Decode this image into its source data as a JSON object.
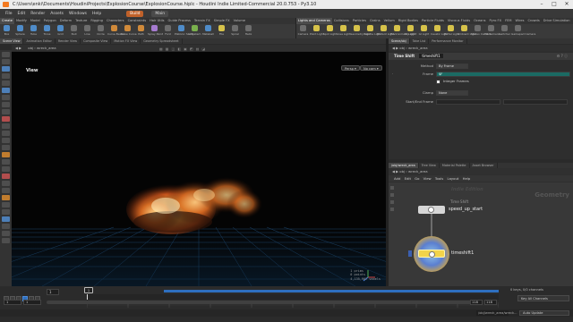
{
  "title_bar": {
    "text": "C:\\Users\\enki\\Documents\\HoudiniProjects\\ExplosionCourse\\ExplosionCourse.hiplc - Houdini Indie Limited-Commercial 20.0.753 - Py3.10"
  },
  "menu": {
    "items": [
      "File",
      "Edit",
      "Render",
      "Assets",
      "Windows",
      "Help"
    ],
    "build": "Build",
    "desktop": "Main"
  },
  "shelf_left": {
    "tabs": [
      "Create",
      "Modify",
      "Model",
      "Polygon",
      "Deform",
      "Texture",
      "Rigging",
      "Characters",
      "Constraints",
      "Hair Utils",
      "Guide Process",
      "Terrain FX",
      "Simple FX",
      "Volume"
    ],
    "tools": [
      "Box",
      "Sphere",
      "Tube",
      "Torus",
      "Grid",
      "Null",
      "Line",
      "Circle",
      "Curve Bezier",
      "Draw Curve",
      "Path",
      "Spray Paint",
      "Font",
      "Platonic Solids",
      "L-System",
      "Metaball",
      "File",
      "Spiral",
      "Helix"
    ]
  },
  "shelf_right": {
    "tabs": [
      "Lights and Cameras",
      "Collisions",
      "Particles",
      "Grains",
      "Vellum",
      "Rigid Bodies",
      "Particle Fluids",
      "Viscous Fluids",
      "Oceans",
      "Pyro FX",
      "FEM",
      "Wires",
      "Crowds",
      "Drive Simulation"
    ],
    "tools": [
      "Camera",
      "Point Light",
      "Spot Light",
      "Area Light",
      "Geometry Light",
      "Volume Light",
      "Distant Light",
      "Environment Light",
      "Sky Light",
      "GI Light",
      "Caustic Light",
      "Portal Light",
      "Ambient Light",
      "Stereo Camera",
      "VR Camera",
      "Switcher",
      "Gamepad Camera"
    ]
  },
  "left_pane_tabs": [
    "Scene View",
    "Animation Editor",
    "Render View",
    "Composite View",
    "Motion FX View",
    "Geometry Spreadsheet"
  ],
  "viewport": {
    "path": [
      "obj",
      "wreck_area"
    ],
    "label": "View",
    "persp": "Persp ▾",
    "cam": "No cam ▾",
    "stats": [
      "1  prims",
      "0  points",
      "4,135,907 voxels"
    ]
  },
  "param_pane": {
    "tabs": [
      "Scene/obj",
      "Take List",
      "Performance Monitor"
    ],
    "path": [
      "obj",
      "wreck_area"
    ],
    "node_type": "Time Shift",
    "node_name": "timeshift1",
    "params": [
      {
        "label": "Method",
        "value": "By Frame"
      },
      {
        "label": "Frame",
        "value": "$F"
      },
      {
        "label": "",
        "value": "Integer Frames"
      },
      {
        "label": "Clamp",
        "value": "None"
      },
      {
        "label": "Start/End Frame",
        "value": ""
      }
    ]
  },
  "network_pane": {
    "tabs": [
      "/obj/wreck_area",
      "Tree View",
      "Material Palette",
      "Asset Browser"
    ],
    "path": [
      "obj",
      "wreck_area"
    ],
    "menu": [
      "Add",
      "Edit",
      "Go",
      "View",
      "Tools",
      "Layout",
      "Help"
    ],
    "context_label": "Indie Edition",
    "geo_label": "Geometry",
    "nodes": [
      {
        "type": "Time Shift",
        "name": "speed_up_start"
      },
      {
        "type": "",
        "name": "timeshift1"
      }
    ]
  },
  "timeline": {
    "current_frame": "1",
    "end_frame": "1",
    "start": "1",
    "range_start": "1",
    "range_end": "118",
    "range_end2": "118",
    "keys_label": "0 keys, 0/0 channels",
    "key_all": "Key All Channels",
    "auto_update": "Auto Update",
    "path": "/obj/wreck_area/wreck..."
  },
  "colors": {
    "accent": "#2e6fbf",
    "houdini_orange": "#f47a20",
    "frame_field": "#1b6a63",
    "node_selected": "#f2d34a"
  }
}
